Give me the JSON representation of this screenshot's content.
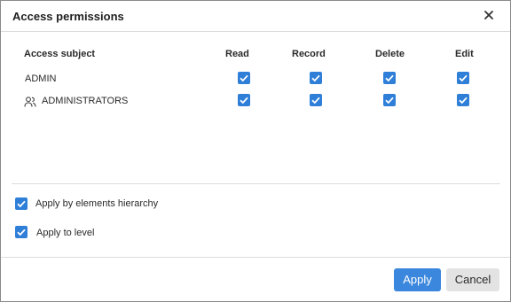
{
  "dialog": {
    "title": "Access permissions",
    "close_icon": "close-icon"
  },
  "table": {
    "headers": {
      "subject": "Access subject",
      "read": "Read",
      "record": "Record",
      "delete": "Delete",
      "edit": "Edit"
    },
    "rows": [
      {
        "name": "ADMIN",
        "icon": "",
        "read": true,
        "record": true,
        "delete": true,
        "edit": true
      },
      {
        "name": "ADMINISTRATORS",
        "icon": "group-icon",
        "read": true,
        "record": true,
        "delete": true,
        "edit": true
      }
    ]
  },
  "options": [
    {
      "label": "Apply by elements hierarchy",
      "checked": true
    },
    {
      "label": "Apply to level",
      "checked": true
    }
  ],
  "buttons": {
    "apply": "Apply",
    "cancel": "Cancel"
  },
  "colors": {
    "accent": "#3b87dd",
    "checkbox": "#2f7fd8"
  }
}
